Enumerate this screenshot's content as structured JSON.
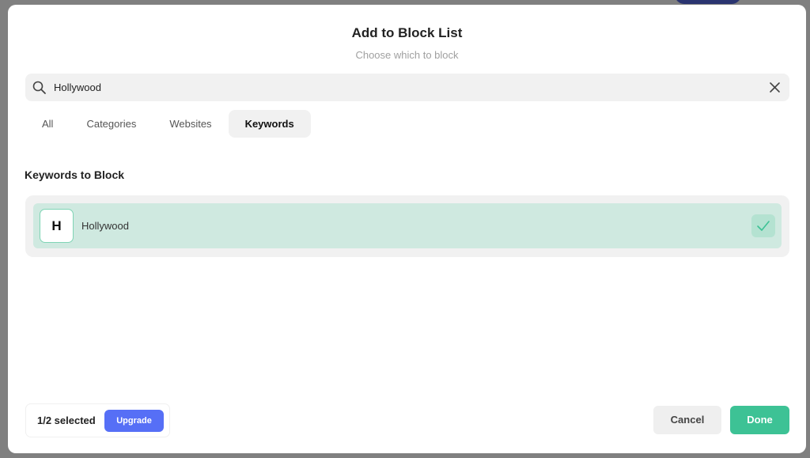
{
  "modal": {
    "title": "Add to Block List",
    "subtitle": "Choose which to block"
  },
  "search": {
    "value": "Hollywood",
    "icon": "search-icon",
    "clear_icon": "close-icon"
  },
  "tabs": [
    {
      "label": "All",
      "active": false
    },
    {
      "label": "Categories",
      "active": false
    },
    {
      "label": "Websites",
      "active": false
    },
    {
      "label": "Keywords",
      "active": true
    }
  ],
  "section": {
    "title": "Keywords to Block"
  },
  "items": [
    {
      "initial": "H",
      "label": "Hollywood",
      "selected": true
    }
  ],
  "footer": {
    "selected_count": "1/2 selected",
    "upgrade_label": "Upgrade",
    "cancel_label": "Cancel",
    "done_label": "Done"
  },
  "colors": {
    "accent_green": "#3dc295",
    "selected_bg": "#cfe9e0",
    "upgrade_blue": "#566ff6"
  }
}
